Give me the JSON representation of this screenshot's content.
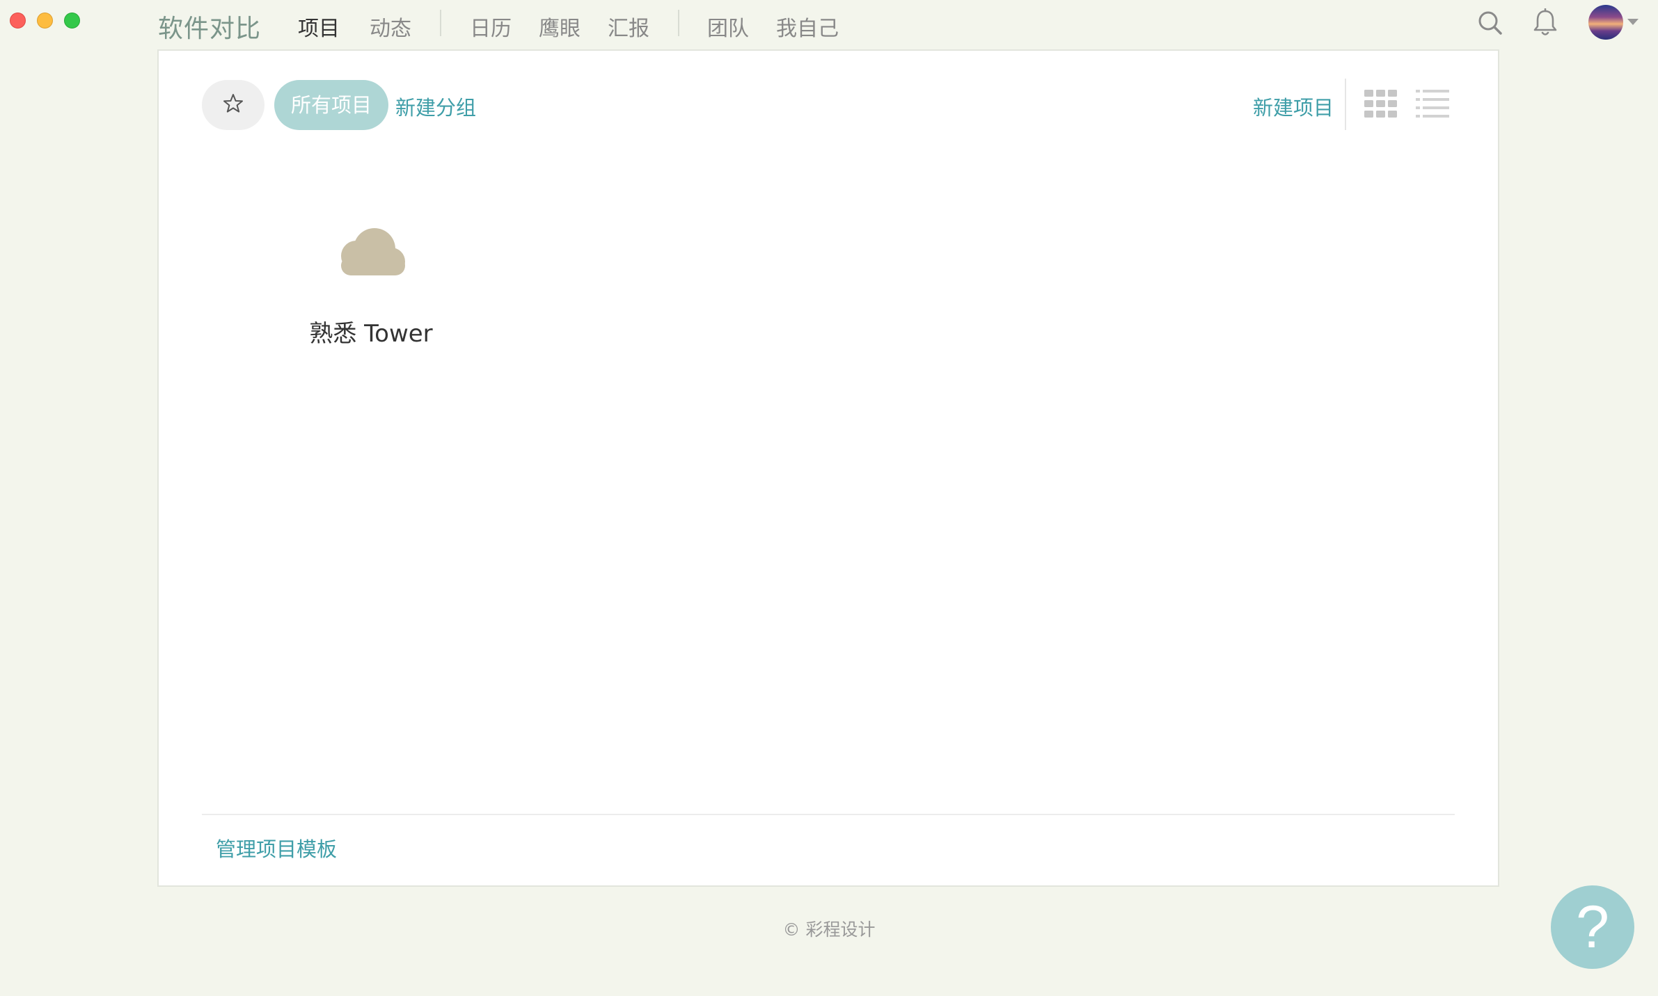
{
  "window": {
    "brand": "软件对比"
  },
  "nav": {
    "items": [
      {
        "label": "项目"
      },
      {
        "label": "动态"
      },
      {
        "label": "日历"
      },
      {
        "label": "鹰眼"
      },
      {
        "label": "汇报"
      },
      {
        "label": "团队"
      },
      {
        "label": "我自己"
      }
    ],
    "active": "项目",
    "icons": [
      "search-icon",
      "bell-icon"
    ]
  },
  "toolbar": {
    "star_icon": "star-icon",
    "filter_all": "所有项目",
    "new_group": "新建分组",
    "new_project": "新建项目",
    "view_icons": [
      "grid-view-icon",
      "list-view-icon"
    ]
  },
  "projects": [
    {
      "name": "熟悉 Tower",
      "icon": "cloud-icon",
      "icon_color": "#c9bfa6"
    }
  ],
  "panel_footer": {
    "manage_templates": "管理项目模板"
  },
  "footer": {
    "copyright": "© 彩程设计"
  },
  "help": {
    "label": "?"
  },
  "colors": {
    "accent": "#3f9ea8",
    "pill": "#aed6d5",
    "background": "#f3f5ec",
    "help": "#9fcfd1"
  }
}
